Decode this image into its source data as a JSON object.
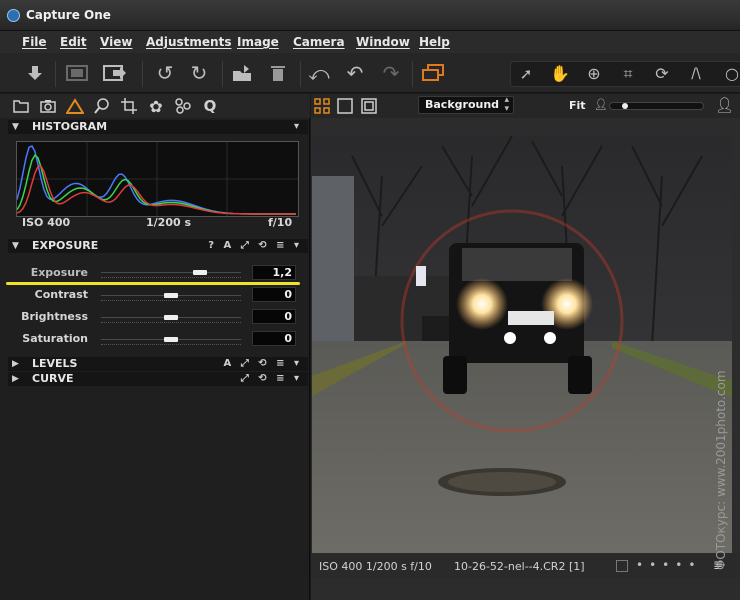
{
  "window": {
    "title": "Capture One"
  },
  "menu": [
    "File",
    "Edit",
    "View",
    "Adjustments",
    "Image",
    "Camera",
    "Window",
    "Help"
  ],
  "toolbar": {
    "icons": [
      "import-icon",
      "fullscreen-icon",
      "export-icon",
      "rotate-left-icon",
      "rotate-right-icon",
      "recipes-icon",
      "delete-icon",
      "undo-icon",
      "undo-step-icon",
      "redo-icon",
      "stack-icon"
    ],
    "cursor_tools": [
      "select-cursor-icon",
      "pan-cursor-icon",
      "zoom-cursor-icon",
      "crop-cursor-icon",
      "rotate-cursor-icon",
      "keystone-cursor-icon",
      "search-cursor-icon"
    ]
  },
  "tool_tabs": [
    "folder-icon",
    "camera-icon",
    "color-icon",
    "inspect-icon",
    "crop-icon",
    "settings-icon",
    "adjust-icon",
    "q-icon"
  ],
  "tool_tabs_q_label": "Q",
  "histogram": {
    "title": "HISTOGRAM",
    "iso": "ISO 400",
    "shutter": "1/200 s",
    "aperture": "f/10",
    "colors": {
      "red": "#e23b3b",
      "green": "#3bd64a",
      "blue": "#4a78ff"
    }
  },
  "exposure": {
    "title": "EXPOSURE",
    "header_tools": "? A ⤢ ⟲ ≡ ▾",
    "sliders": [
      {
        "label": "Exposure",
        "value": "1,2",
        "level": 0.73
      },
      {
        "label": "Contrast",
        "value": "0",
        "level": 0.5
      },
      {
        "label": "Brightness",
        "value": "0",
        "level": 0.5
      },
      {
        "label": "Saturation",
        "value": "0",
        "level": 0.5
      }
    ],
    "highlight_color": "#f1e22a"
  },
  "levels": {
    "title": "LEVELS",
    "header_tools": "A ⤢ ⟲ ≡ ▾"
  },
  "curve": {
    "title": "CURVE",
    "header_tools": "⤢ ⟲ ≡ ▾"
  },
  "viewer": {
    "background_select": "Background",
    "zoom_label": "Fit",
    "status": {
      "exposure_info": "ISO 400 1/200 s f/10",
      "filename": "10-26-52-nel--4.CR2 [1]"
    },
    "watermark": "ФОТОкурс: www.2001photo.com"
  }
}
